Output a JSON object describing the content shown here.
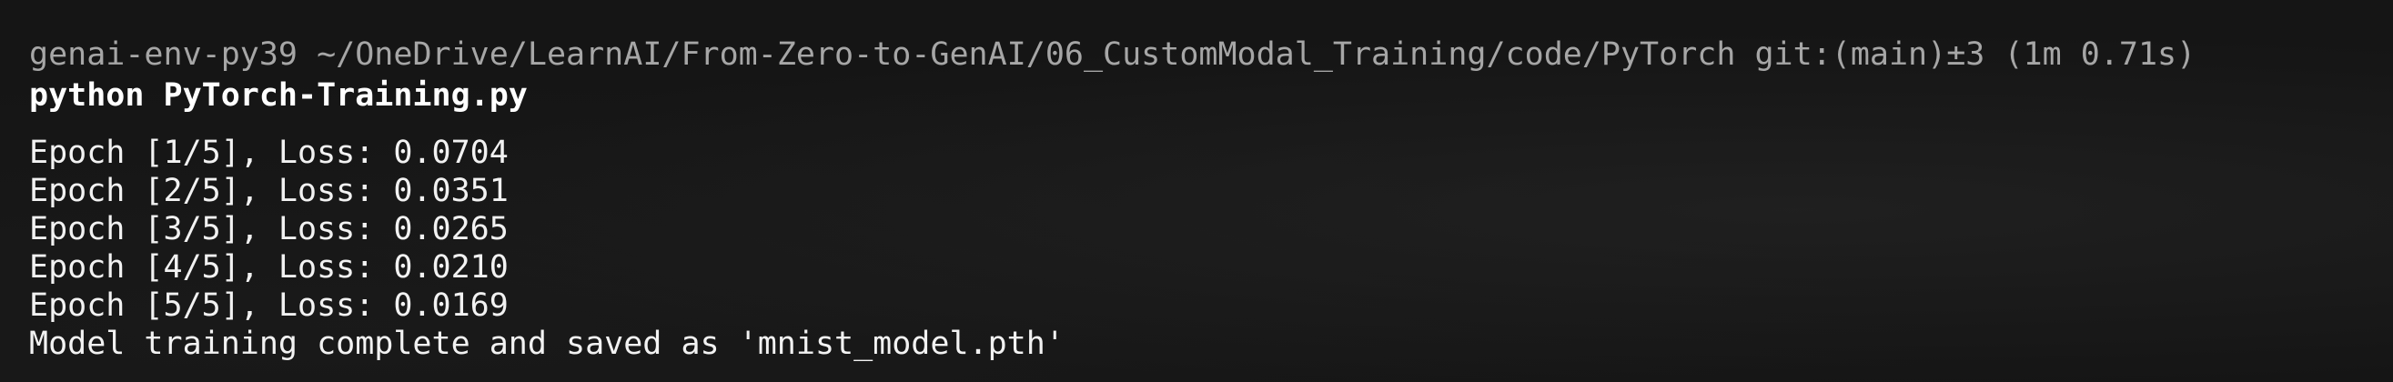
{
  "terminal": {
    "prompt": {
      "env": "genai-env-py39",
      "path": "~/OneDrive/LearnAI/From-Zero-to-GenAI/06_CustomModal_Training/code/PyTorch",
      "git": "git:(main)±3",
      "duration": "(1m 0.71s)"
    },
    "command": "python PyTorch-Training.py",
    "output": [
      "Epoch [1/5], Loss: 0.0704",
      "Epoch [2/5], Loss: 0.0351",
      "Epoch [3/5], Loss: 0.0265",
      "Epoch [4/5], Loss: 0.0210",
      "Epoch [5/5], Loss: 0.0169",
      "Model training complete and saved as 'mnist_model.pth'"
    ]
  }
}
